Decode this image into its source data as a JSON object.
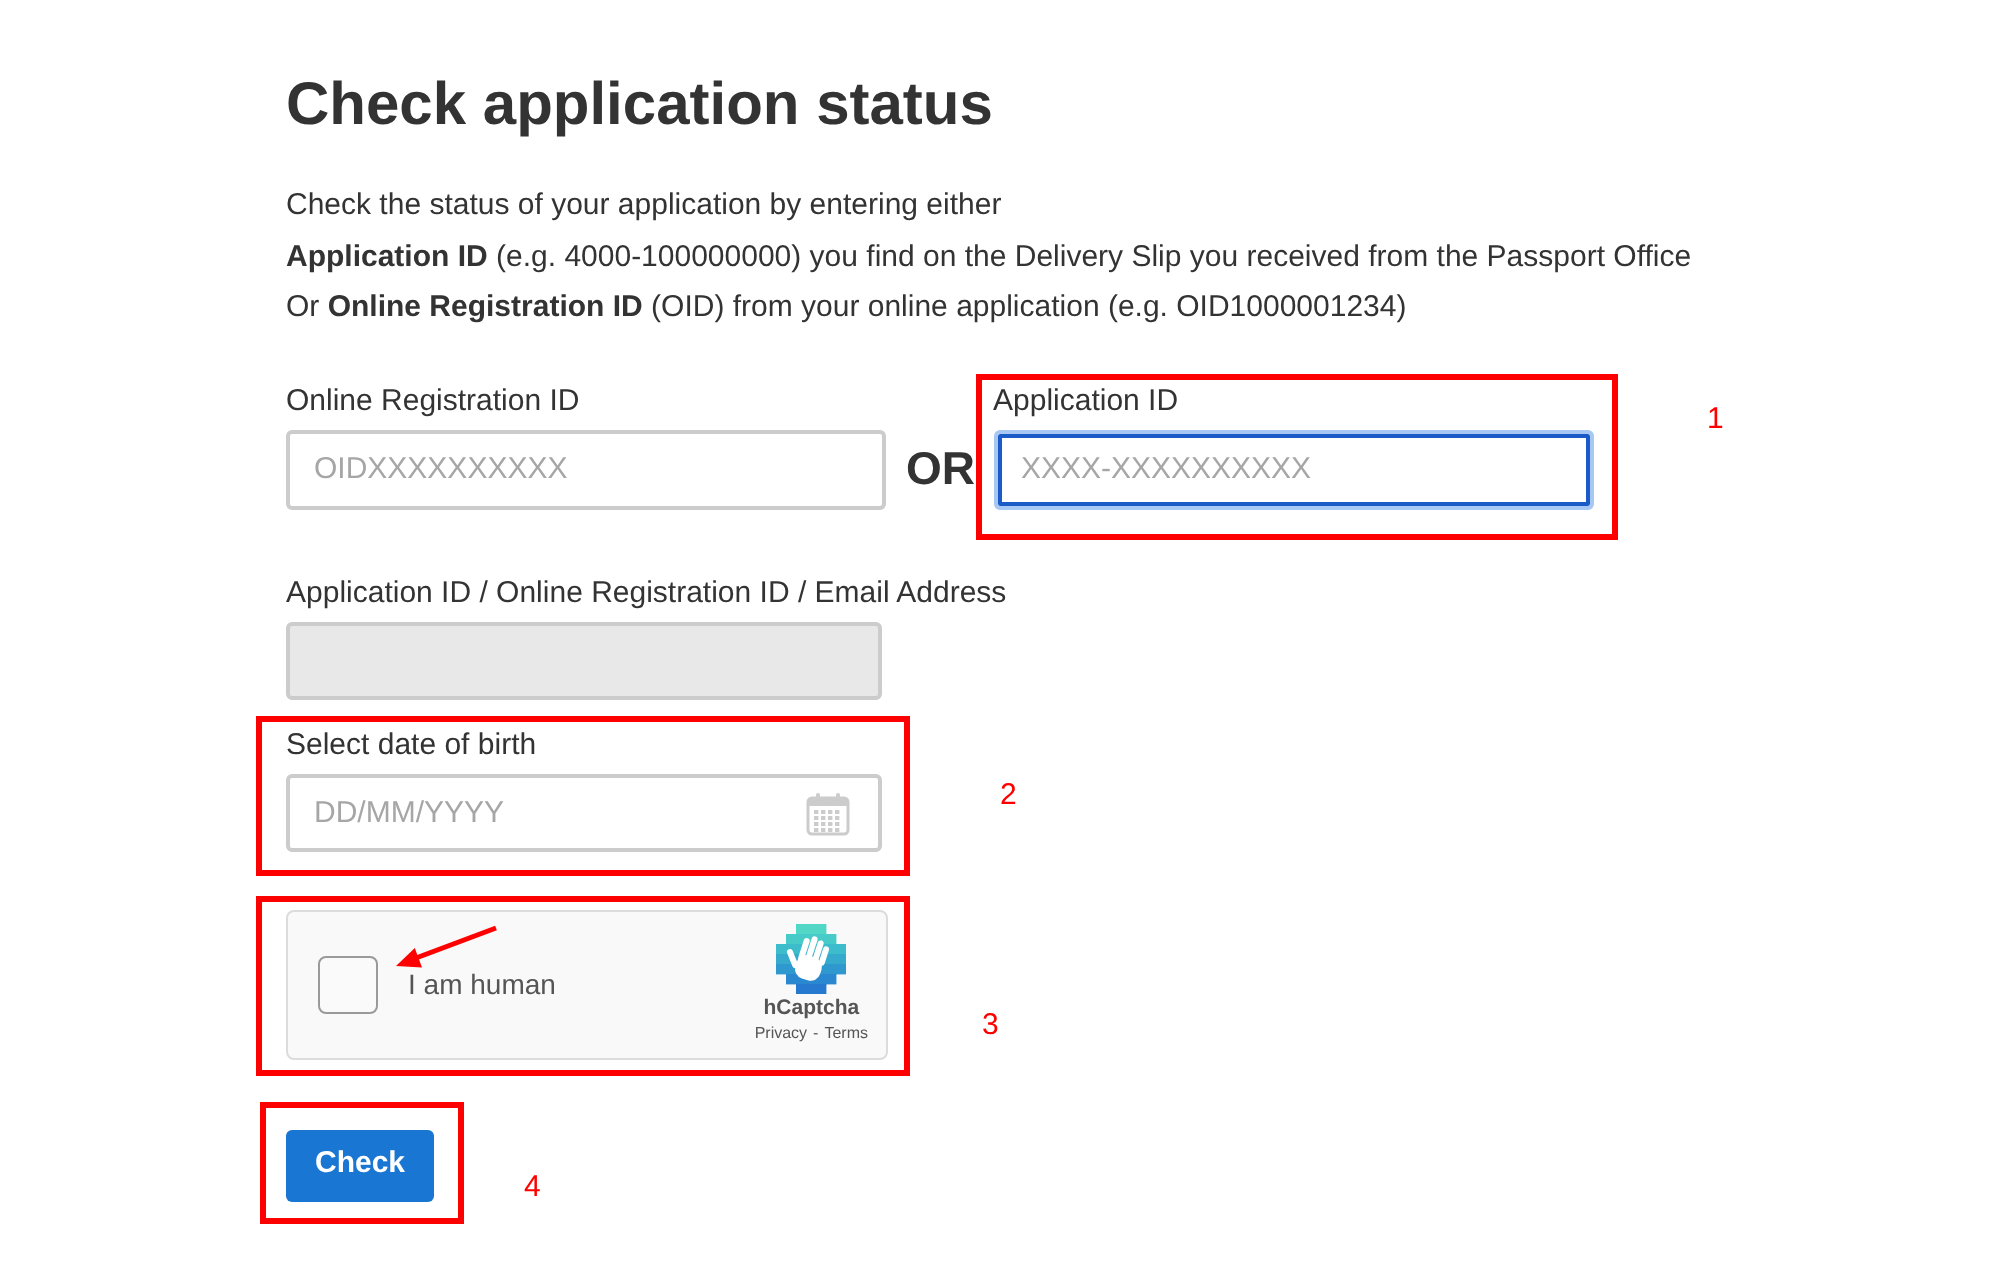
{
  "page": {
    "title": "Check application status"
  },
  "intro": [
    "Check the status of your application by entering either",
    "**Application ID** (e.g. 4000-100000000) you find on the Delivery Slip you received from the Passport Office",
    "Or **Online Registration ID** (OID) from your online application (e.g. OID1000001234)"
  ],
  "id_choice": {
    "online_registration_id": {
      "label": "Online Registration ID",
      "placeholder": "OIDXXXXXXXXXX",
      "focused": false
    },
    "separator": "OR",
    "application_id": {
      "label": "Application ID",
      "placeholder": "XXXX-XXXXXXXXXX",
      "focused": true,
      "annotation": "1"
    }
  },
  "lookup_field": {
    "label": "Application ID / Online Registration ID / Email Address",
    "disabled": true
  },
  "date_of_birth": {
    "label": "Select date of birth",
    "placeholder": "DD/MM/YYYY",
    "annotation": "2"
  },
  "captcha": {
    "checked": false,
    "label": "I am human",
    "brand": "hCaptcha",
    "links": [
      "Privacy",
      "Terms"
    ],
    "link_separator": "-",
    "annotation": "3"
  },
  "submit": {
    "label": "Check",
    "annotation": "4"
  }
}
